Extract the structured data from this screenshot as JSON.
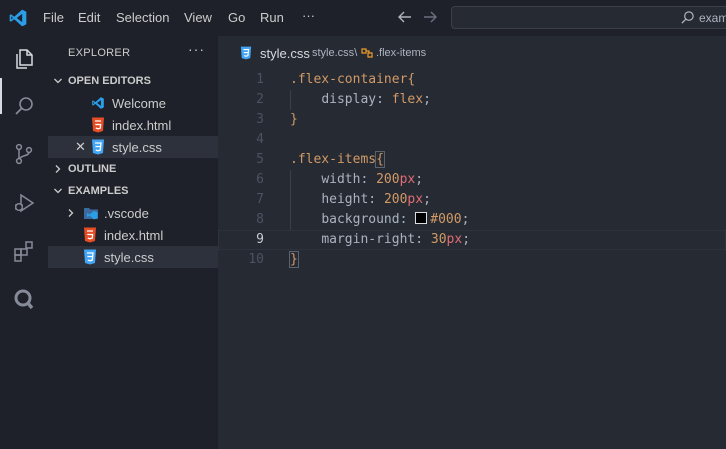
{
  "menu": {
    "file": "File",
    "edit": "Edit",
    "selection": "Selection",
    "view": "View",
    "go": "Go",
    "run": "Run",
    "more": "···"
  },
  "search": {
    "placeholder": "examples"
  },
  "sidebar": {
    "title": "EXPLORER",
    "actions": "···",
    "open_editors": {
      "label": "OPEN EDITORS",
      "items": [
        {
          "label": "Welcome",
          "icon": "vscode-icon"
        },
        {
          "label": "index.html",
          "icon": "html5-icon"
        },
        {
          "label": "style.css",
          "icon": "css3-icon",
          "close": "✕"
        }
      ]
    },
    "outline": {
      "label": "OUTLINE"
    },
    "examples": {
      "label": "EXAMPLES",
      "items": [
        {
          "label": ".vscode",
          "icon": "folder-vscode-icon"
        },
        {
          "label": "index.html",
          "icon": "html5-icon"
        },
        {
          "label": "style.css",
          "icon": "css3-icon"
        }
      ]
    }
  },
  "editor": {
    "tab": "style.css",
    "breadcrumb": {
      "file": "style.css",
      "separator": "\\",
      "symbol": ".flex-items"
    },
    "current_line": 9,
    "lines": [
      {
        "n": "1",
        "selector": ".flex-container",
        "brace": "{"
      },
      {
        "n": "2",
        "prop": "display",
        "value": "flex"
      },
      {
        "n": "3",
        "brace": "}"
      },
      {
        "n": "4"
      },
      {
        "n": "5",
        "selector": ".flex-items",
        "brace": "{"
      },
      {
        "n": "6",
        "prop": "width",
        "num": "200",
        "unit": "px"
      },
      {
        "n": "7",
        "prop": "height",
        "num": "200",
        "unit": "px"
      },
      {
        "n": "8",
        "prop": "background",
        "value": "#000",
        "swatch": "#000000"
      },
      {
        "n": "9",
        "prop": "margin-right",
        "num": "30",
        "unit": "px"
      },
      {
        "n": "10",
        "brace": "}"
      }
    ]
  },
  "colors": {
    "accent": "#007acc",
    "css": "#42a5f5",
    "html": "#e44d26",
    "vscode": "#0098ff"
  }
}
